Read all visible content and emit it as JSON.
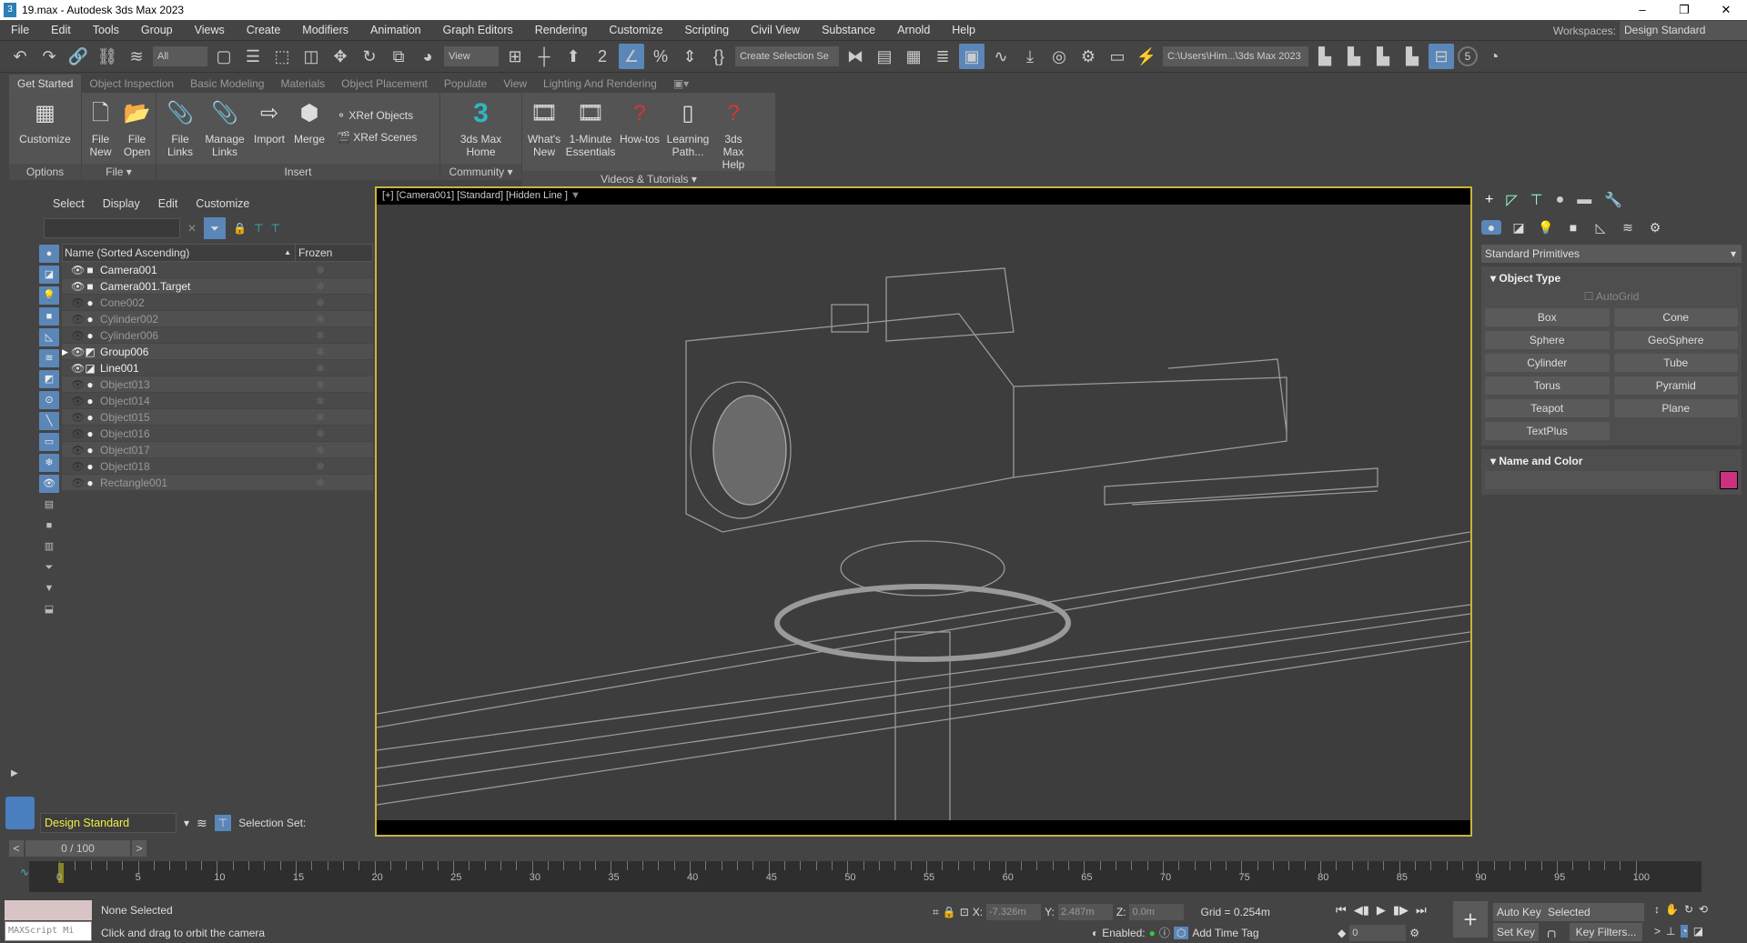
{
  "window": {
    "title": "19.max - Autodesk 3ds Max 2023",
    "app_icon": "3",
    "controls": [
      "minimize-icon",
      "restore-icon",
      "close-icon"
    ]
  },
  "menu": [
    "File",
    "Edit",
    "Tools",
    "Group",
    "Views",
    "Create",
    "Modifiers",
    "Animation",
    "Graph Editors",
    "Rendering",
    "Customize",
    "Scripting",
    "Civil View",
    "Substance",
    "Arnold",
    "Help"
  ],
  "workspaces": {
    "label": "Workspaces:",
    "value": "Design Standard"
  },
  "toolbar": {
    "filter": "All",
    "ref_coord": "View",
    "selection_set": "Create Selection Se",
    "project_path": "C:\\Users\\Him...\\3ds Max 2023",
    "autobackup": "5"
  },
  "ribbon": {
    "tabs": [
      "Get Started",
      "Object Inspection",
      "Basic Modeling",
      "Materials",
      "Object Placement",
      "Populate",
      "View",
      "Lighting And Rendering"
    ],
    "groups": [
      {
        "label": "Options",
        "buttons": [
          "Customize"
        ]
      },
      {
        "label": "File ▾",
        "buttons": [
          "File New",
          "File Open"
        ]
      },
      {
        "label": "Insert",
        "buttons": [
          "File Links",
          "Manage Links",
          "Import",
          "Merge"
        ],
        "small": [
          "XRef Objects",
          "XRef Scenes"
        ]
      },
      {
        "label": "Community ▾",
        "buttons": [
          "3ds Max Home"
        ]
      },
      {
        "label": "Videos & Tutorials ▾",
        "buttons": [
          "What's New",
          "1-Minute Essentials",
          "How-tos",
          "Learning Path...",
          "3ds Max Help"
        ]
      }
    ]
  },
  "scene_explorer": {
    "menu": [
      "Select",
      "Display",
      "Edit",
      "Customize"
    ],
    "search_placeholder": "",
    "col_name": "Name (Sorted Ascending)",
    "col_frozen": "Frozen",
    "rows": [
      {
        "name": "Camera001",
        "visible": true,
        "type": "camera"
      },
      {
        "name": "Camera001.Target",
        "visible": true,
        "type": "camera"
      },
      {
        "name": "Cone002",
        "visible": false,
        "type": "geometry"
      },
      {
        "name": "Cylinder002",
        "visible": false,
        "type": "geometry"
      },
      {
        "name": "Cylinder006",
        "visible": false,
        "type": "geometry"
      },
      {
        "name": "Group006",
        "visible": true,
        "type": "group",
        "expandable": true
      },
      {
        "name": "Line001",
        "visible": true,
        "type": "shape"
      },
      {
        "name": "Object013",
        "visible": false,
        "type": "geometry"
      },
      {
        "name": "Object014",
        "visible": false,
        "type": "geometry"
      },
      {
        "name": "Object015",
        "visible": false,
        "type": "geometry"
      },
      {
        "name": "Object016",
        "visible": false,
        "type": "geometry"
      },
      {
        "name": "Object017",
        "visible": false,
        "type": "geometry"
      },
      {
        "name": "Object018",
        "visible": false,
        "type": "geometry"
      },
      {
        "name": "Rectangle001",
        "visible": false,
        "type": "geometry"
      }
    ]
  },
  "viewport": {
    "label": "[+] [Camera001] [Standard] [Hidden Line ]",
    "border_color": "#c9b53a"
  },
  "layer_bar": {
    "layer": "Design Standard",
    "selection_set_label": "Selection Set:"
  },
  "command_panel": {
    "category": "Standard Primitives",
    "object_type_title": "Object Type",
    "autogrid": "AutoGrid",
    "primitives": [
      "Box",
      "Cone",
      "Sphere",
      "GeoSphere",
      "Cylinder",
      "Tube",
      "Torus",
      "Pyramid",
      "Teapot",
      "Plane",
      "TextPlus"
    ],
    "name_color_title": "Name and Color",
    "name_value": "",
    "color": "#c8327f"
  },
  "time": {
    "slider": "0 / 100",
    "prev": "<",
    "next": ">",
    "ticks": [
      "0",
      "5",
      "10",
      "15",
      "20",
      "25",
      "30",
      "35",
      "40",
      "45",
      "50",
      "55",
      "60",
      "65",
      "70",
      "75",
      "80",
      "85",
      "90",
      "95",
      "100"
    ]
  },
  "status": {
    "maxscript": "MAXScript Mi",
    "selection": "None Selected",
    "prompt": "Click and drag to orbit the camera",
    "x_label": "X:",
    "x": "-7.326m",
    "y_label": "Y:",
    "y": "2.487m",
    "z_label": "Z:",
    "z": "0.0m",
    "grid": "Grid = 0.254m",
    "enabled_label": "Enabled:",
    "add_time_tag": "Add Time Tag",
    "frame": "0",
    "auto_key": "Auto Key",
    "set_key": "Set Key",
    "key_mode": "Selected",
    "key_filters": "Key Filters..."
  }
}
